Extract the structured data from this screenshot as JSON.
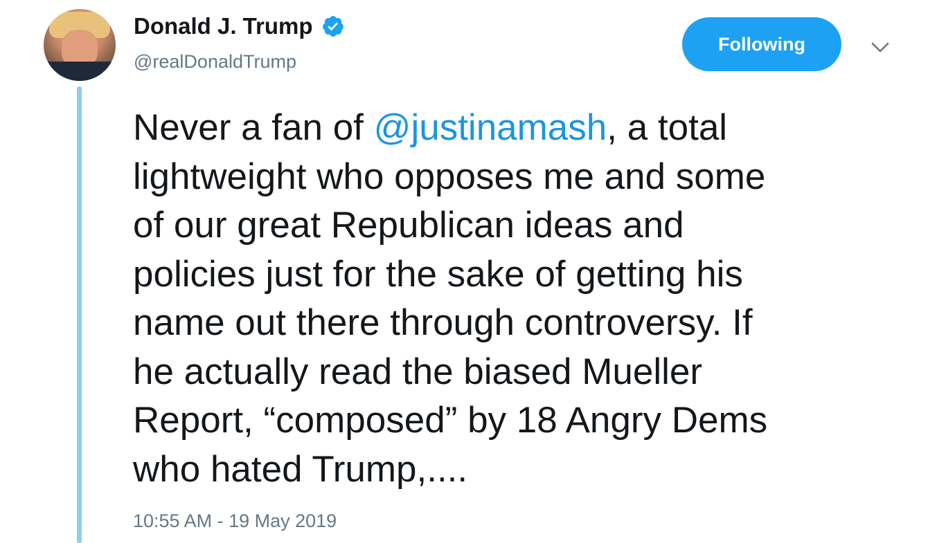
{
  "author": {
    "display_name": "Donald J. Trump",
    "handle": "@realDonaldTrump",
    "verified_icon": "verified-badge-icon"
  },
  "actions": {
    "follow_label": "Following",
    "menu_icon": "chevron-down-icon"
  },
  "tweet": {
    "line1_before": "Never a fan of ",
    "line1_mention": "@justinamash",
    "line1_after": ", a total",
    "line2": "lightweight who opposes me and some",
    "line3": "of our great Republican ideas and",
    "line4": "policies just for the sake of getting his",
    "line5": "name out there through controversy. If",
    "line6": "he actually read the biased Mueller",
    "line7": "Report, “composed” by 18 Angry Dems",
    "line8": "who hated Trump,....",
    "timestamp": "10:55 AM - 19 May 2019"
  },
  "colors": {
    "accent": "#1da1f2",
    "link": "#1b95e0",
    "thread_line": "#8ecdf0",
    "secondary_text": "#657786"
  }
}
